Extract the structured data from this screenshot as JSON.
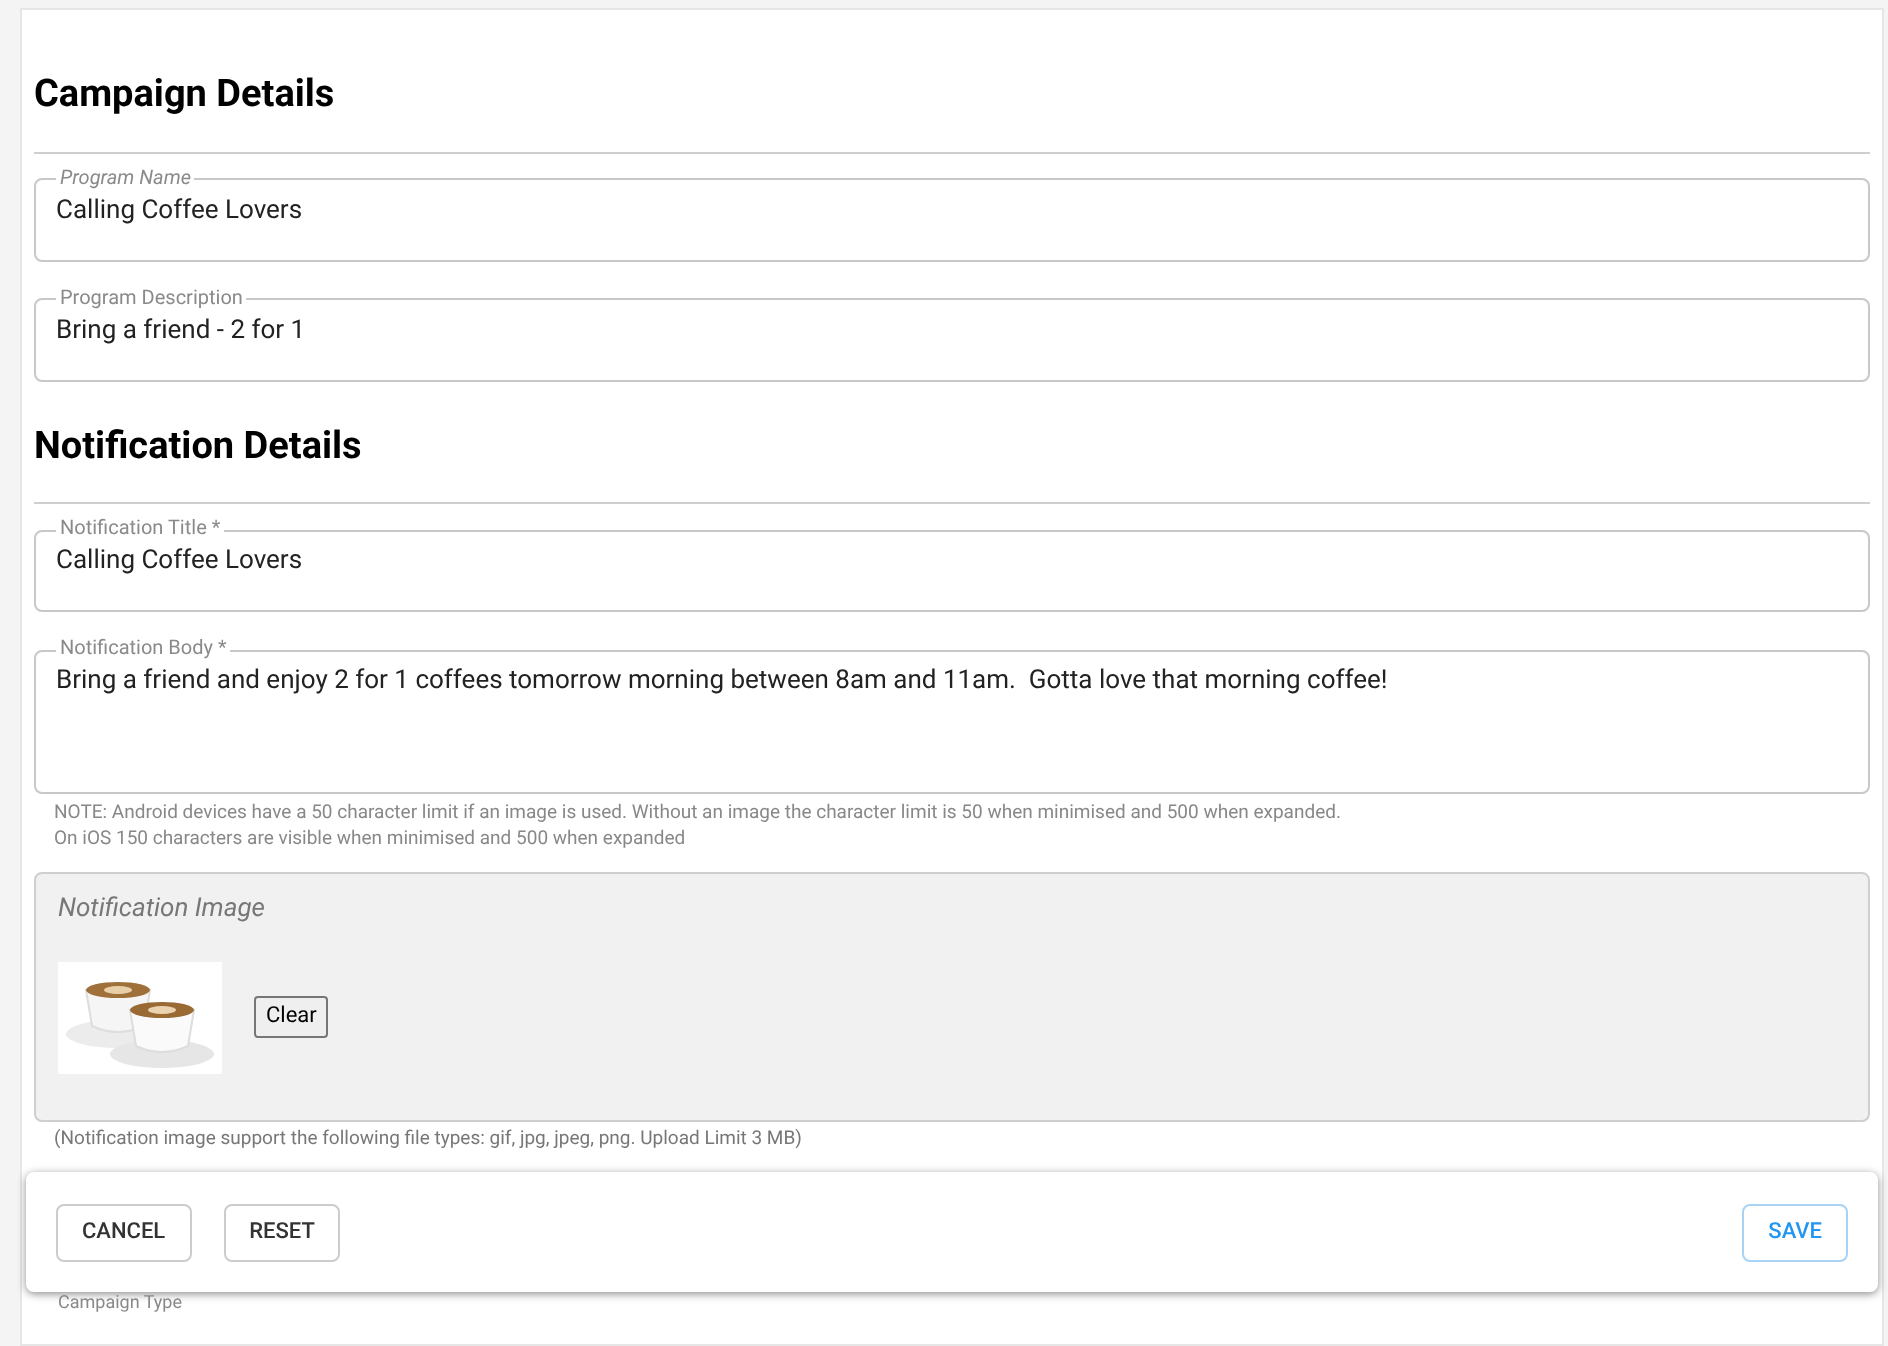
{
  "sections": [
    {
      "title": "Campaign Details",
      "fields": [
        {
          "label": "Program Name",
          "value": "Calling Coffee Lovers",
          "italic_label": true,
          "multiline": false
        },
        {
          "label": "Program Description",
          "value": "Bring a friend - 2 for 1",
          "italic_label": false,
          "multiline": false
        }
      ]
    },
    {
      "title": "Notification Details",
      "fields": [
        {
          "label": "Notification Title *",
          "value": "Calling Coffee Lovers",
          "italic_label": false,
          "multiline": false
        },
        {
          "label": "Notification Body *",
          "value": "Bring a friend and enjoy 2 for 1 coffees tomorrow morning between 8am and 11am.  Gotta love that morning coffee!",
          "italic_label": false,
          "multiline": true
        }
      ]
    }
  ],
  "note": [
    "NOTE: Android devices have a 50 character limit if an image is used. Without an image the character limit is 50 when minimised and 500 when expanded.",
    "On iOS 150 characters are visible when minimised and 500 when expanded"
  ],
  "image_panel": {
    "title": "Notification Image",
    "clear_button": "Clear",
    "help": "(Notification image support the following file types: gif, jpg, jpeg, png. Upload Limit 3 MB)"
  },
  "actions": {
    "left": [
      "CANCEL",
      "RESET"
    ],
    "right": [
      "SAVE"
    ]
  },
  "next_field_label": "Campaign Type"
}
